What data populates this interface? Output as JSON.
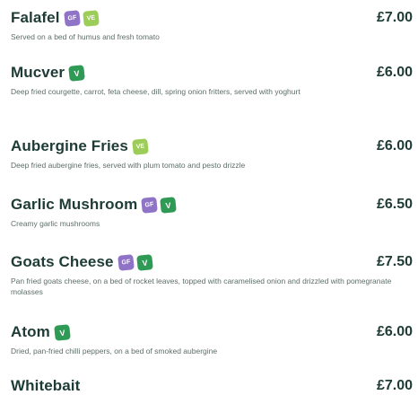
{
  "items": [
    {
      "name": "Falafel",
      "price": "£7.00",
      "badges": [
        {
          "type": "gf",
          "text": "GF"
        },
        {
          "type": "ve",
          "text": "VE"
        }
      ],
      "description": "Served on a bed of humus and fresh tomato"
    },
    {
      "name": "Mucver",
      "price": "£6.00",
      "badges": [
        {
          "type": "v",
          "text": "V"
        }
      ],
      "description": "Deep fried courgette, carrot, feta cheese, dill, spring onion fritters, served with yoghurt"
    },
    {
      "name": "Aubergine Fries",
      "price": "£6.00",
      "badges": [
        {
          "type": "ve",
          "text": "VE"
        }
      ],
      "description": "Deep fried aubergine fries, served with plum tomato and pesto drizzle"
    },
    {
      "name": "Garlic Mushroom",
      "price": "£6.50",
      "badges": [
        {
          "type": "gf",
          "text": "GF"
        },
        {
          "type": "v",
          "text": "V"
        }
      ],
      "description": "Creamy garlic mushrooms"
    },
    {
      "name": "Goats Cheese",
      "price": "£7.50",
      "badges": [
        {
          "type": "gf",
          "text": "GF"
        },
        {
          "type": "v",
          "text": "V"
        }
      ],
      "description": "Pan fried goats cheese, on a bed of rocket leaves, topped with caramelised onion and drizzled with pomegranate molasses"
    },
    {
      "name": "Atom",
      "price": "£6.00",
      "badges": [
        {
          "type": "v",
          "text": "V"
        }
      ],
      "description": "Dried, pan-fried chilli peppers, on a bed of smoked aubergine"
    },
    {
      "name": "Whitebait",
      "price": "£7.00",
      "badges": [],
      "description": ""
    }
  ]
}
